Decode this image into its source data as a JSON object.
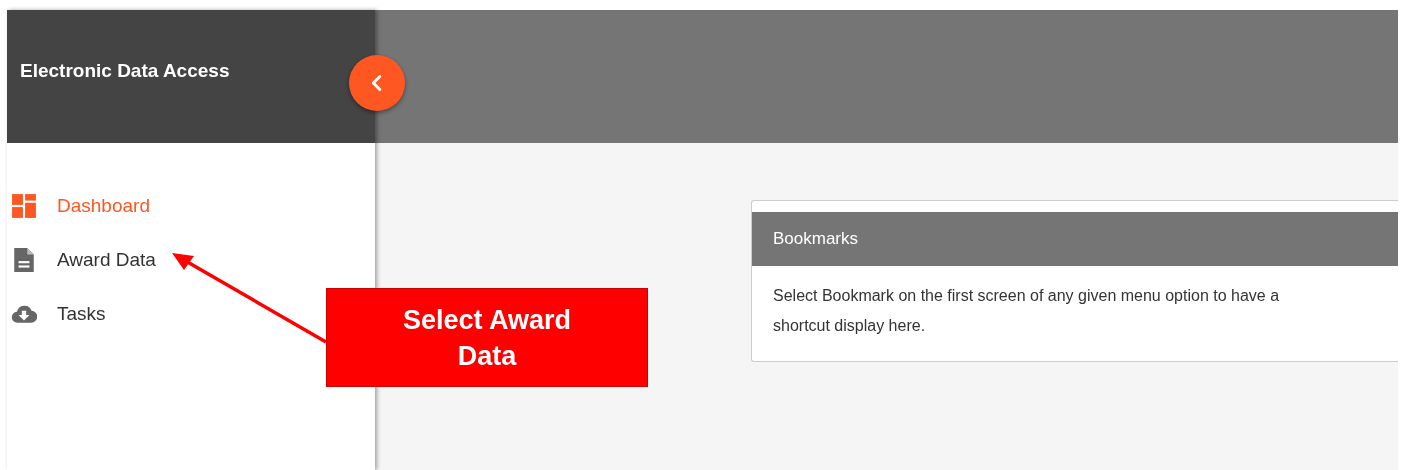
{
  "app": {
    "title": "Electronic Data Access"
  },
  "sidebar": {
    "items": [
      {
        "label": "Dashboard",
        "kind": "dashboard",
        "selected": true
      },
      {
        "label": "Award Data",
        "kind": "document",
        "selected": false
      },
      {
        "label": "Tasks",
        "kind": "cloud",
        "selected": false
      }
    ]
  },
  "bookmarks": {
    "title": "Bookmarks",
    "message": "Select Bookmark on the first screen of any given menu option to have a shortcut display here."
  },
  "callout": {
    "text": "Select Award Data"
  }
}
